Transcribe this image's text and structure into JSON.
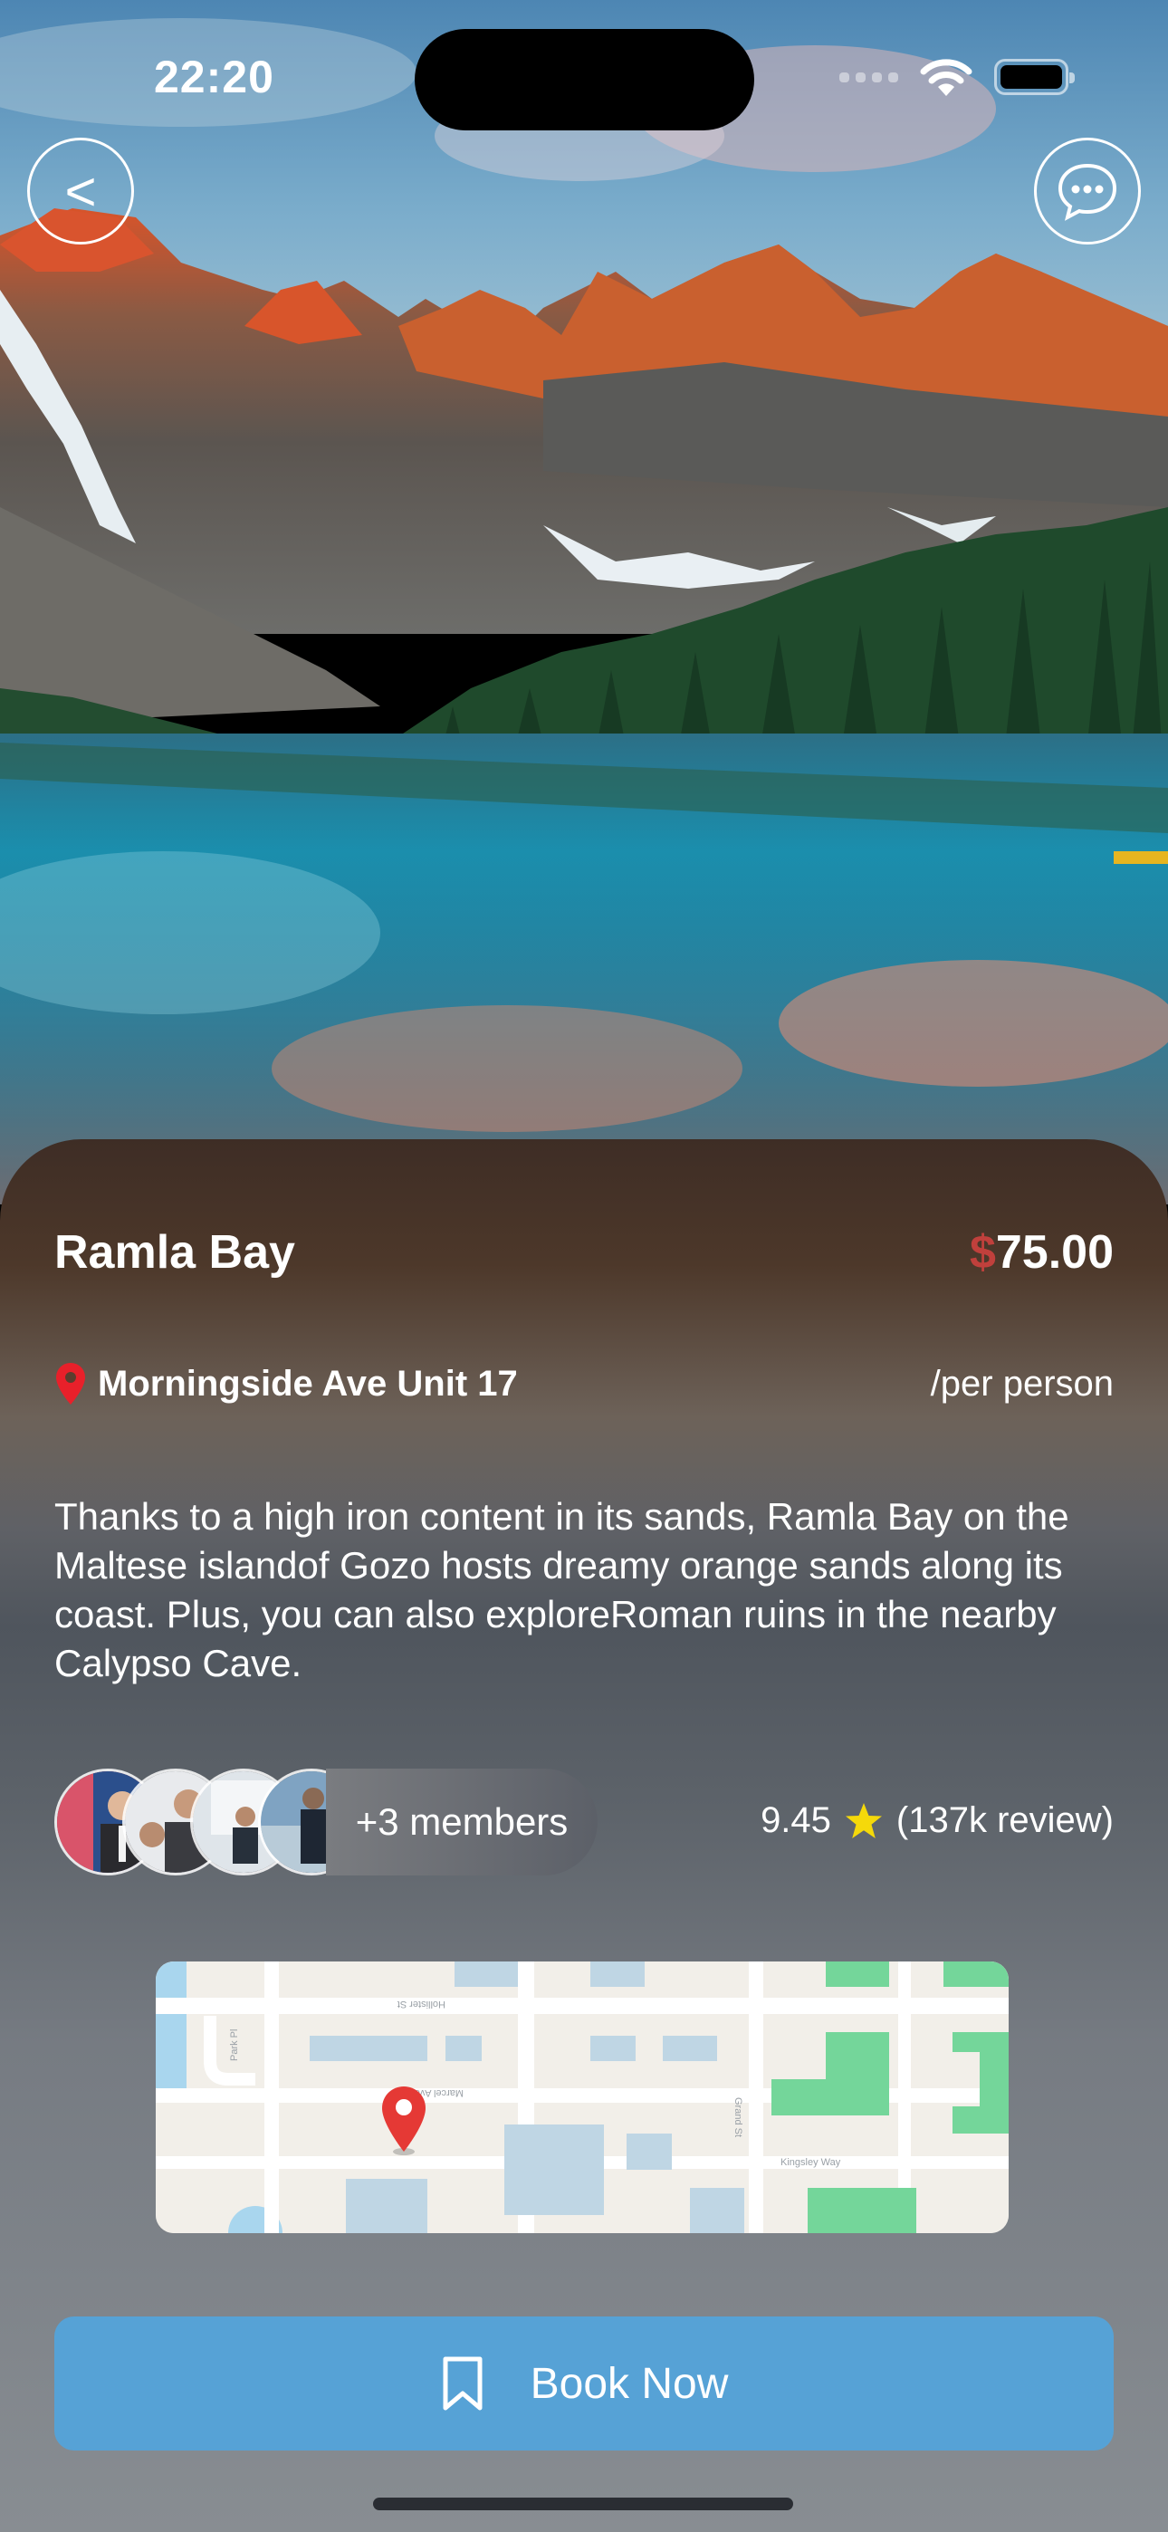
{
  "status_bar": {
    "time": "22:20"
  },
  "hero": {
    "image": "mountain-lake-landscape"
  },
  "header": {
    "back_label": "<"
  },
  "place": {
    "title": "Ramla Bay",
    "price_currency": "$",
    "price_amount": "75.00",
    "location": "Morningside Ave Unit 17",
    "price_unit": "/per person",
    "description": "Thanks to a high iron content in its sands, Ramla Bay on the Maltese islandof Gozo hosts dreamy orange sands along its coast. Plus, you can also exploreRoman ruins in the nearby Calypso Cave.",
    "members_label": "+3 members",
    "rating": "9.45",
    "reviews": "(137k review)"
  },
  "map": {
    "pin_color": "#e53935"
  },
  "actions": {
    "book_label": "Book Now"
  },
  "colors": {
    "accent": "#56a2d6",
    "price_currency": "#c0403c",
    "pin": "#e8202a",
    "star": "#f5d90a"
  }
}
